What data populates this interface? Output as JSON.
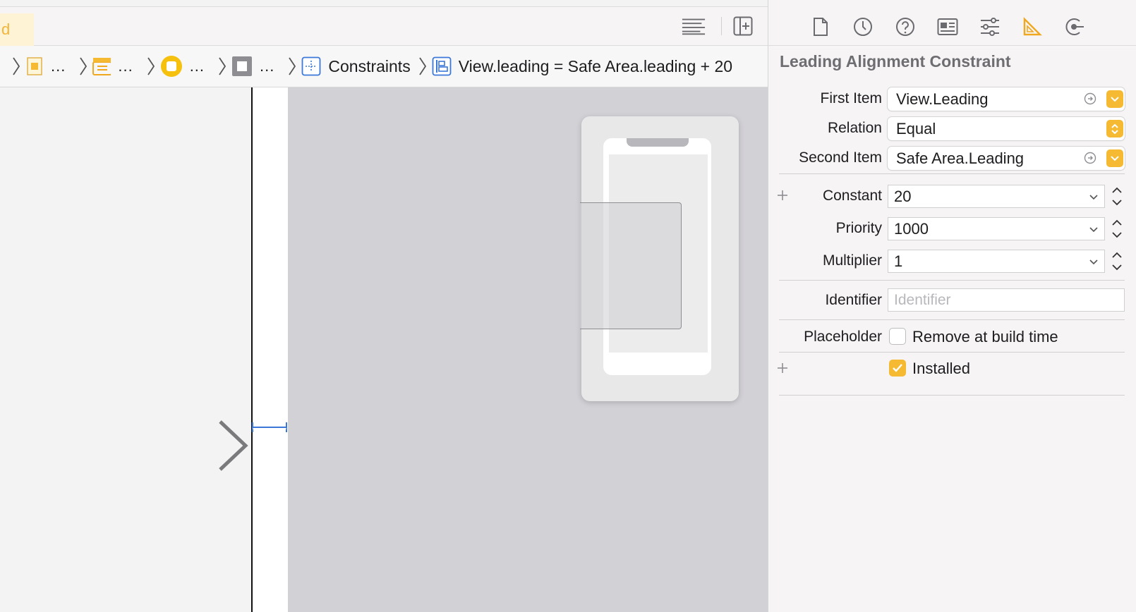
{
  "file_tab": {
    "label": "d"
  },
  "jump_bar": {
    "items": [
      {
        "icon": "storyboard-file-icon",
        "label": "..."
      },
      {
        "icon": "scene-icon",
        "label": "..."
      },
      {
        "icon": "view-controller-icon",
        "label": "..."
      },
      {
        "icon": "view-icon",
        "label": "..."
      },
      {
        "icon": "constraints-icon",
        "label": "Constraints"
      },
      {
        "icon": "leading-constraint-icon",
        "label": "View.leading = Safe Area.leading + 20"
      }
    ]
  },
  "toolbar": {
    "icons": [
      "editor-options-icon",
      "add-editor-icon"
    ]
  },
  "inspector": {
    "tabs": [
      "file-inspector-icon",
      "history-icon",
      "quick-help-icon",
      "identity-inspector-icon",
      "attributes-inspector-icon",
      "size-inspector-icon",
      "connections-inspector-icon"
    ],
    "selected_tab": "size-inspector-icon",
    "title": "Leading Alignment Constraint",
    "first_item": {
      "label": "First Item",
      "value": "View.Leading"
    },
    "relation": {
      "label": "Relation",
      "value": "Equal"
    },
    "second_item": {
      "label": "Second Item",
      "value": "Safe Area.Leading"
    },
    "constant": {
      "label": "Constant",
      "value": "20"
    },
    "priority": {
      "label": "Priority",
      "value": "1000"
    },
    "multiplier": {
      "label": "Multiplier",
      "value": "1"
    },
    "identifier": {
      "label": "Identifier",
      "placeholder": "Identifier",
      "value": ""
    },
    "placeholder": {
      "label": "Placeholder",
      "checkbox_label": "Remove at build time",
      "checked": false
    },
    "installed": {
      "label": "Installed",
      "checked": true
    }
  },
  "colors": {
    "accent": "#f5b932",
    "canvas": "#d2d1d6",
    "constraint_blue": "#3b78d8"
  }
}
